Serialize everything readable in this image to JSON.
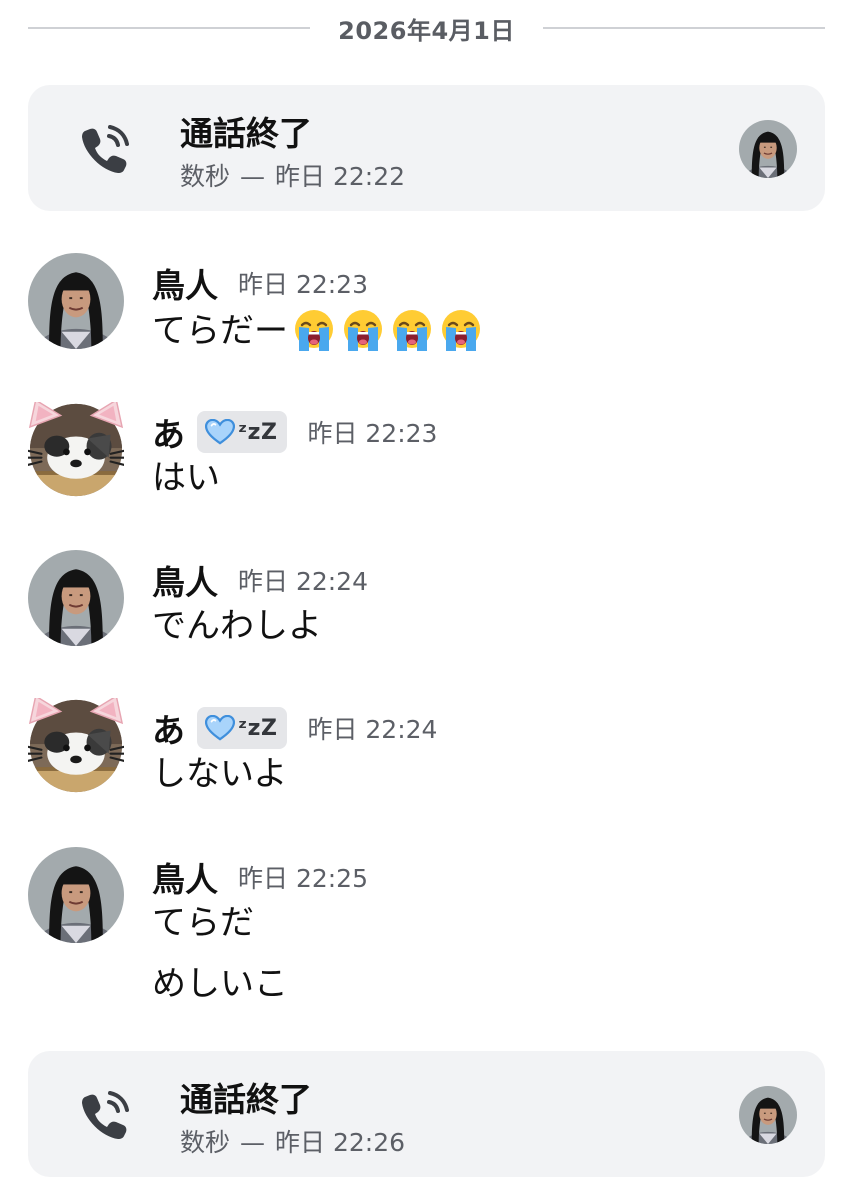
{
  "date_divider": "2026年4月1日",
  "calls": [
    {
      "title": "通話終了",
      "duration": "数秒",
      "separator": "—",
      "time": "昨日 22:22"
    },
    {
      "title": "通話終了",
      "duration": "数秒",
      "separator": "—",
      "time": "昨日 22:26"
    }
  ],
  "messages": [
    {
      "author": "鳥人",
      "time": "昨日 22:23",
      "lines": [
        "てらだー"
      ],
      "emoji": [
        "loudly-crying-face",
        "loudly-crying-face",
        "loudly-crying-face",
        "loudly-crying-face"
      ]
    },
    {
      "author": "あ",
      "badge": "ᶻzZ",
      "time": "昨日 22:23",
      "lines": [
        "はい"
      ]
    },
    {
      "author": "鳥人",
      "time": "昨日 22:24",
      "lines": [
        "でんわしよ"
      ]
    },
    {
      "author": "あ",
      "badge": "ᶻzZ",
      "time": "昨日 22:24",
      "lines": [
        "しないよ"
      ]
    },
    {
      "author": "鳥人",
      "time": "昨日 22:25",
      "lines": [
        "てらだ",
        "めしいこ"
      ]
    }
  ],
  "icons": {
    "call": "phone-icon",
    "badge": "blue-heart-icon",
    "emoji": "loudly-crying-face-emoji"
  },
  "colors": {
    "card_background": "#f2f3f5",
    "secondary_text": "#5c5f66",
    "badge_background": "#e5e6e9",
    "heart": "#5aa9f0"
  }
}
